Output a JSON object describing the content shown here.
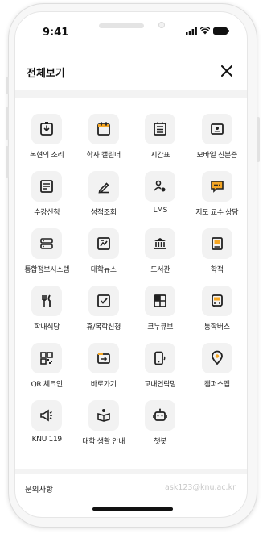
{
  "status": {
    "time": "9:41"
  },
  "header": {
    "title": "전체보기",
    "close_icon": "close-icon"
  },
  "menu": [
    {
      "label": "복현의 소리",
      "icon": "voice-icon"
    },
    {
      "label": "학사 캘린더",
      "icon": "calendar-icon"
    },
    {
      "label": "시간표",
      "icon": "timetable-icon"
    },
    {
      "label": "모바일 신분증",
      "icon": "id-card-icon"
    },
    {
      "label": "수강신청",
      "icon": "course-icon"
    },
    {
      "label": "성적조회",
      "icon": "grade-icon"
    },
    {
      "label": "LMS",
      "icon": "lms-icon"
    },
    {
      "label": "지도 교수 상담",
      "icon": "advisor-chat-icon"
    },
    {
      "label": "통합정보시스템",
      "icon": "system-icon"
    },
    {
      "label": "대학뉴스",
      "icon": "news-icon"
    },
    {
      "label": "도서관",
      "icon": "library-icon"
    },
    {
      "label": "학적",
      "icon": "record-icon"
    },
    {
      "label": "학내식당",
      "icon": "cafeteria-icon"
    },
    {
      "label": "휴/복학신청",
      "icon": "checkbox-icon"
    },
    {
      "label": "크누큐브",
      "icon": "cube-icon"
    },
    {
      "label": "통학버스",
      "icon": "bus-icon"
    },
    {
      "label": "QR 체크인",
      "icon": "qr-icon"
    },
    {
      "label": "바로가기",
      "icon": "shortcut-icon"
    },
    {
      "label": "교내연락망",
      "icon": "phone-icon"
    },
    {
      "label": "캠퍼스맵",
      "icon": "map-pin-icon"
    },
    {
      "label": "KNU 119",
      "icon": "megaphone-icon"
    },
    {
      "label": "대학 생활 안내",
      "icon": "guide-icon"
    },
    {
      "label": "챗봇",
      "icon": "chatbot-icon"
    }
  ],
  "footer": {
    "label": "문의사항",
    "email": "ask123@knu.ac.kr"
  },
  "colors": {
    "icon_dark": "#222222",
    "tile_bg": "#f2f2f2",
    "muted": "#c9c9c9"
  }
}
